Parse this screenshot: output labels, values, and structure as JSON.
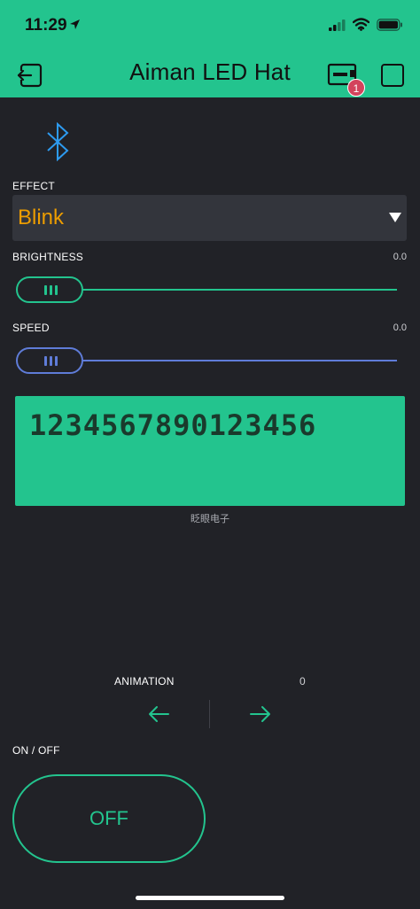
{
  "status_bar": {
    "time": "11:29"
  },
  "header": {
    "title": "Aiman LED Hat",
    "badge_count": "1"
  },
  "colors": {
    "accent": "#23c48e",
    "effect_value": "#ed9d00",
    "speed_thumb": "#5f7cd8",
    "badge": "#d3435c",
    "background": "#212227"
  },
  "icons": {
    "back": "exit-icon",
    "device": "device-icon",
    "square": "square-icon",
    "bluetooth": "bluetooth-icon",
    "caret": "caret-down-icon",
    "prev": "arrow-left-icon",
    "next": "arrow-right-icon"
  },
  "effect": {
    "label": "EFFECT",
    "value": "Blink"
  },
  "brightness": {
    "label": "BRIGHTNESS",
    "value": "0.0"
  },
  "speed": {
    "label": "SPEED",
    "value": "0.0"
  },
  "lcd": {
    "text": "1234567890123456",
    "caption": "眨眼电子"
  },
  "animation": {
    "label": "ANIMATION",
    "value": "0"
  },
  "onoff": {
    "label": "ON / OFF",
    "button_label": "OFF"
  }
}
